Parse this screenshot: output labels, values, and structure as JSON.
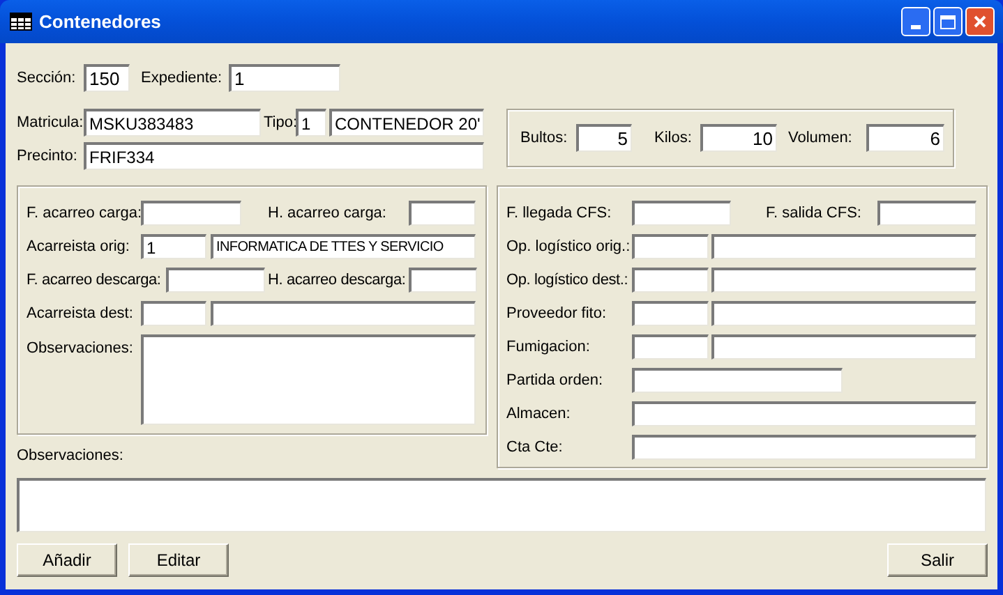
{
  "window": {
    "title": "Contenedores"
  },
  "seccion": {
    "label": "Sección:",
    "value": "150"
  },
  "expediente": {
    "label": "Expediente:",
    "value": "1"
  },
  "matricula": {
    "label": "Matricula:",
    "value": "MSKU383483"
  },
  "tipo": {
    "label": "Tipo:",
    "code": "1",
    "name": "CONTENEDOR 20'"
  },
  "precinto": {
    "label": "Precinto:",
    "value": "FRIF334"
  },
  "bultos": {
    "label": "Bultos:",
    "value": "5"
  },
  "kilos": {
    "label": "Kilos:",
    "value": "10"
  },
  "volumen": {
    "label": "Volumen:",
    "value": "6"
  },
  "acarreo": {
    "f_carga": "F. acarreo carga:",
    "h_carga": "H. acarreo carga:",
    "orig": {
      "label": "Acarreista orig:",
      "code": "1",
      "name": "INFORMATICA DE TTES Y SERVICIO"
    },
    "f_descarga": "F. acarreo descarga:",
    "h_descarga": "H. acarreo descarga:",
    "dest": "Acarreista dest:",
    "observaciones": "Observaciones:"
  },
  "cfs": {
    "f_llegada": "F. llegada CFS:",
    "f_salida": "F. salida CFS:",
    "op_orig": "Op. logístico orig.:",
    "op_dest": "Op. logístico dest.:",
    "proveedor": "Proveedor fito:",
    "fumigacion": "Fumigacion:",
    "partida": "Partida orden:",
    "almacen": "Almacen:",
    "cta": "Cta Cte:"
  },
  "observaciones": {
    "label": "Observaciones:"
  },
  "buttons": [
    "Añadir",
    "Editar",
    "Salir"
  ]
}
